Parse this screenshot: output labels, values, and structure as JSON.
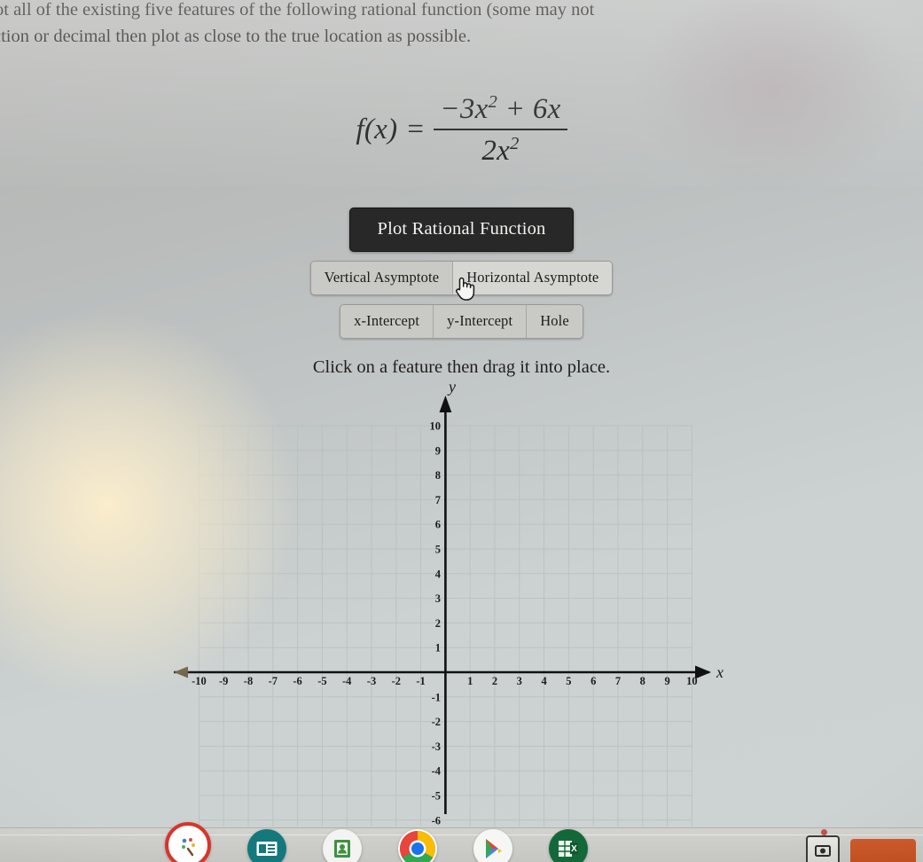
{
  "instructions": {
    "line1": "ot all of the existing five features of the following rational function (some may not",
    "line2": "ction or decimal then plot as close to the true location as possible."
  },
  "formula": {
    "lhs": "f(x)",
    "equals": "=",
    "numerator_a": "−3x",
    "numerator_exp": "2",
    "numerator_b": "+ 6x",
    "denominator_a": "2x",
    "denominator_exp": "2",
    "plain": "f(x) = (-3x^2 + 6x) / (2x^2)"
  },
  "buttons": {
    "plot": "Plot Rational Function",
    "asymptote_row": [
      {
        "label": "Vertical Asymptote",
        "hover": false
      },
      {
        "label": "Horizontal Asymptote",
        "hover": true
      }
    ],
    "intercept_row": [
      {
        "label": "x-Intercept",
        "hover": false
      },
      {
        "label": "y-Intercept",
        "hover": false
      },
      {
        "label": "Hole",
        "hover": false
      }
    ]
  },
  "hint": "Click on a feature then drag it into place.",
  "cursor": {
    "icon": "pointing-hand-cursor"
  },
  "chart_data": {
    "type": "scatter",
    "title": "",
    "xlabel": "x",
    "ylabel": "y",
    "xlim": [
      -10.5,
      10.5
    ],
    "ylim": [
      -6.5,
      10.5
    ],
    "xticks": [
      -10,
      -9,
      -8,
      -7,
      -6,
      -5,
      -4,
      -3,
      -2,
      -1,
      1,
      2,
      3,
      4,
      5,
      6,
      7,
      8,
      9,
      10
    ],
    "yticks": [
      10,
      9,
      8,
      7,
      6,
      5,
      4,
      3,
      2,
      1,
      -1,
      -2,
      -3,
      -4,
      -5,
      -6
    ],
    "xtick_labels": [
      "-10",
      "-9",
      "-8",
      "-7",
      "-6",
      "-5",
      "-4",
      "-3",
      "-2",
      "-1",
      "1",
      "2",
      "3",
      "4",
      "5",
      "6",
      "7",
      "8",
      "9",
      "10"
    ],
    "ytick_labels": [
      "10",
      "9",
      "8",
      "7",
      "6",
      "5",
      "4",
      "3",
      "2",
      "1",
      "-1",
      "-2",
      "-3",
      "-4",
      "-5",
      "-6"
    ],
    "grid": true,
    "grid_color": "#b9c2c2",
    "axis_color": "#121212",
    "legend": null,
    "series": [],
    "annotations": [],
    "axis_arrows": [
      "left",
      "right",
      "up"
    ],
    "note": "Empty coordinate plane; no features plotted yet"
  },
  "taskbar": {
    "icons": [
      {
        "name": "paint-palette-icon",
        "color": "#d8352a"
      },
      {
        "name": "news-document-icon",
        "color": "#13797d"
      },
      {
        "name": "contacts-card-icon",
        "color": "#f1f1ef"
      },
      {
        "name": "chrome-browser-icon",
        "color": "#e8453c"
      },
      {
        "name": "play-store-icon",
        "color": "#f4f4f2"
      },
      {
        "name": "spreadsheet-icon",
        "color": "#13683a"
      }
    ],
    "system_tray": {
      "screenshot_icon": "screenshot-icon",
      "chip_label": ""
    }
  },
  "colors": {
    "page_bg": "#c6cccc",
    "primary_button_bg": "#282828",
    "segmented_button_bg": "#c9c9c6",
    "grid": "#b9c2c2",
    "axis": "#121212"
  }
}
